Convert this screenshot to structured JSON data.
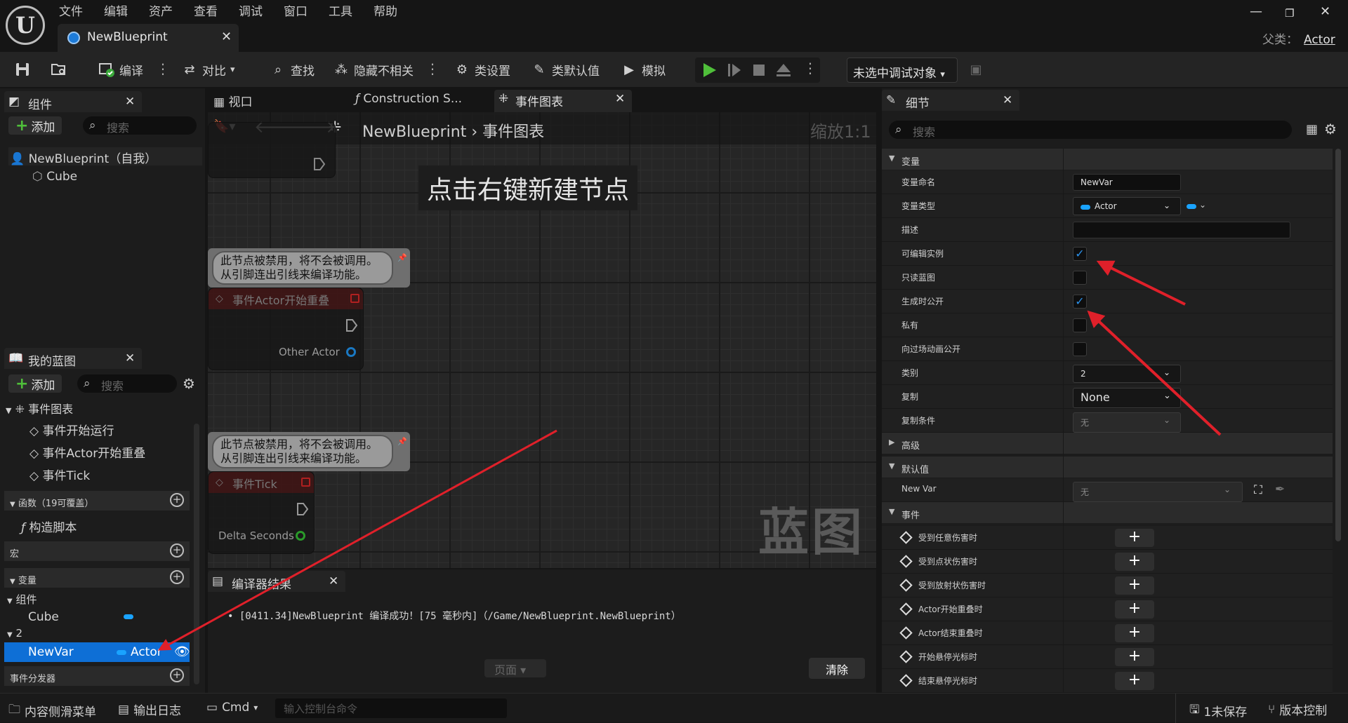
{
  "menu": [
    "文件",
    "编辑",
    "资产",
    "查看",
    "调试",
    "窗口",
    "工具",
    "帮助"
  ],
  "doc_tab": {
    "label": "NewBlueprint"
  },
  "parent_class": {
    "label": "父类：",
    "value": "Actor"
  },
  "toolbar": {
    "compile": "编译",
    "diff": "对比",
    "find": "查找",
    "hide_unrelated": "隐藏不相关",
    "class_settings": "类设置",
    "class_defaults": "类默认值",
    "simulate": "模拟",
    "debug_target": "未选中调试对象"
  },
  "components_panel": {
    "title": "组件",
    "add": "添加",
    "search_placeholder": "搜索",
    "root": "NewBlueprint（自我）",
    "child": "Cube"
  },
  "my_blueprint": {
    "title": "我的蓝图",
    "add": "添加",
    "search_placeholder": "搜索",
    "event_graph": "事件图表",
    "events": [
      "事件开始运行",
      "事件Actor开始重叠",
      "事件Tick"
    ],
    "functions_header": "函数（19可覆盖）",
    "construction_script": "构造脚本",
    "macros_header": "宏",
    "variables_header": "变量",
    "components_category": "组件",
    "cube_var": "Cube",
    "category_2": "2",
    "newvar_name": "NewVar",
    "newvar_type": "Actor",
    "dispatchers_header": "事件分发器"
  },
  "graph_tabs": {
    "viewport": "视口",
    "construction": "Construction S...",
    "event_graph": "事件图表"
  },
  "graph": {
    "breadcrumb_root": "NewBlueprint",
    "breadcrumb_leaf": "事件图表",
    "zoom": "缩放1:1",
    "hint": "点击右键新建节点",
    "watermark": "蓝图",
    "comment_text_1": "此节点被禁用，将不会被调用。",
    "comment_text_2": "从引脚连出引线来编译功能。",
    "node_overlap_title": "事件Actor开始重叠",
    "node_overlap_pin": "Other Actor",
    "node_tick_title": "事件Tick",
    "node_tick_pin": "Delta Seconds"
  },
  "compiler": {
    "title": "编译器结果",
    "log": "[0411.34]NewBlueprint 编译成功！[75 毫秒内]（/Game/NewBlueprint.NewBlueprint）",
    "page": "页面",
    "clear": "清除"
  },
  "details": {
    "title": "细节",
    "search_placeholder": "搜索",
    "sec_variable": "变量",
    "var_name_label": "变量命名",
    "var_name_value": "NewVar",
    "var_type_label": "变量类型",
    "var_type_value": "Actor",
    "desc_label": "描述",
    "instance_editable_label": "可编辑实例",
    "instance_editable": true,
    "readonly_label": "只读蓝图",
    "readonly": false,
    "expose_spawn_label": "生成时公开",
    "expose_spawn": true,
    "private_label": "私有",
    "private": false,
    "expose_cinematics_label": "向过场动画公开",
    "expose_cinematics": false,
    "category_label": "类别",
    "category_value": "2",
    "replication_label": "复制",
    "replication_value": "None",
    "rep_condition_label": "复制条件",
    "rep_condition_value": "无",
    "sec_advanced": "高级",
    "sec_default": "默认值",
    "default_label": "New Var",
    "default_value": "无",
    "sec_events": "事件",
    "events": [
      "受到任意伤害时",
      "受到点状伤害时",
      "受到放射状伤害时",
      "Actor开始重叠时",
      "Actor结束重叠时",
      "开始悬停光标时",
      "结束悬停光标时"
    ]
  },
  "statusbar": {
    "content_drawer": "内容侧滑菜单",
    "output_log": "输出日志",
    "cmd": "Cmd",
    "console_placeholder": "输入控制台命令",
    "unsaved": "1未保存",
    "source_control": "版本控制"
  },
  "colors": {
    "accent": "#0e6fd6",
    "play_green": "#4fbf3a",
    "annotation_red": "#e0202a",
    "object_pin": "#1aa3ff"
  }
}
